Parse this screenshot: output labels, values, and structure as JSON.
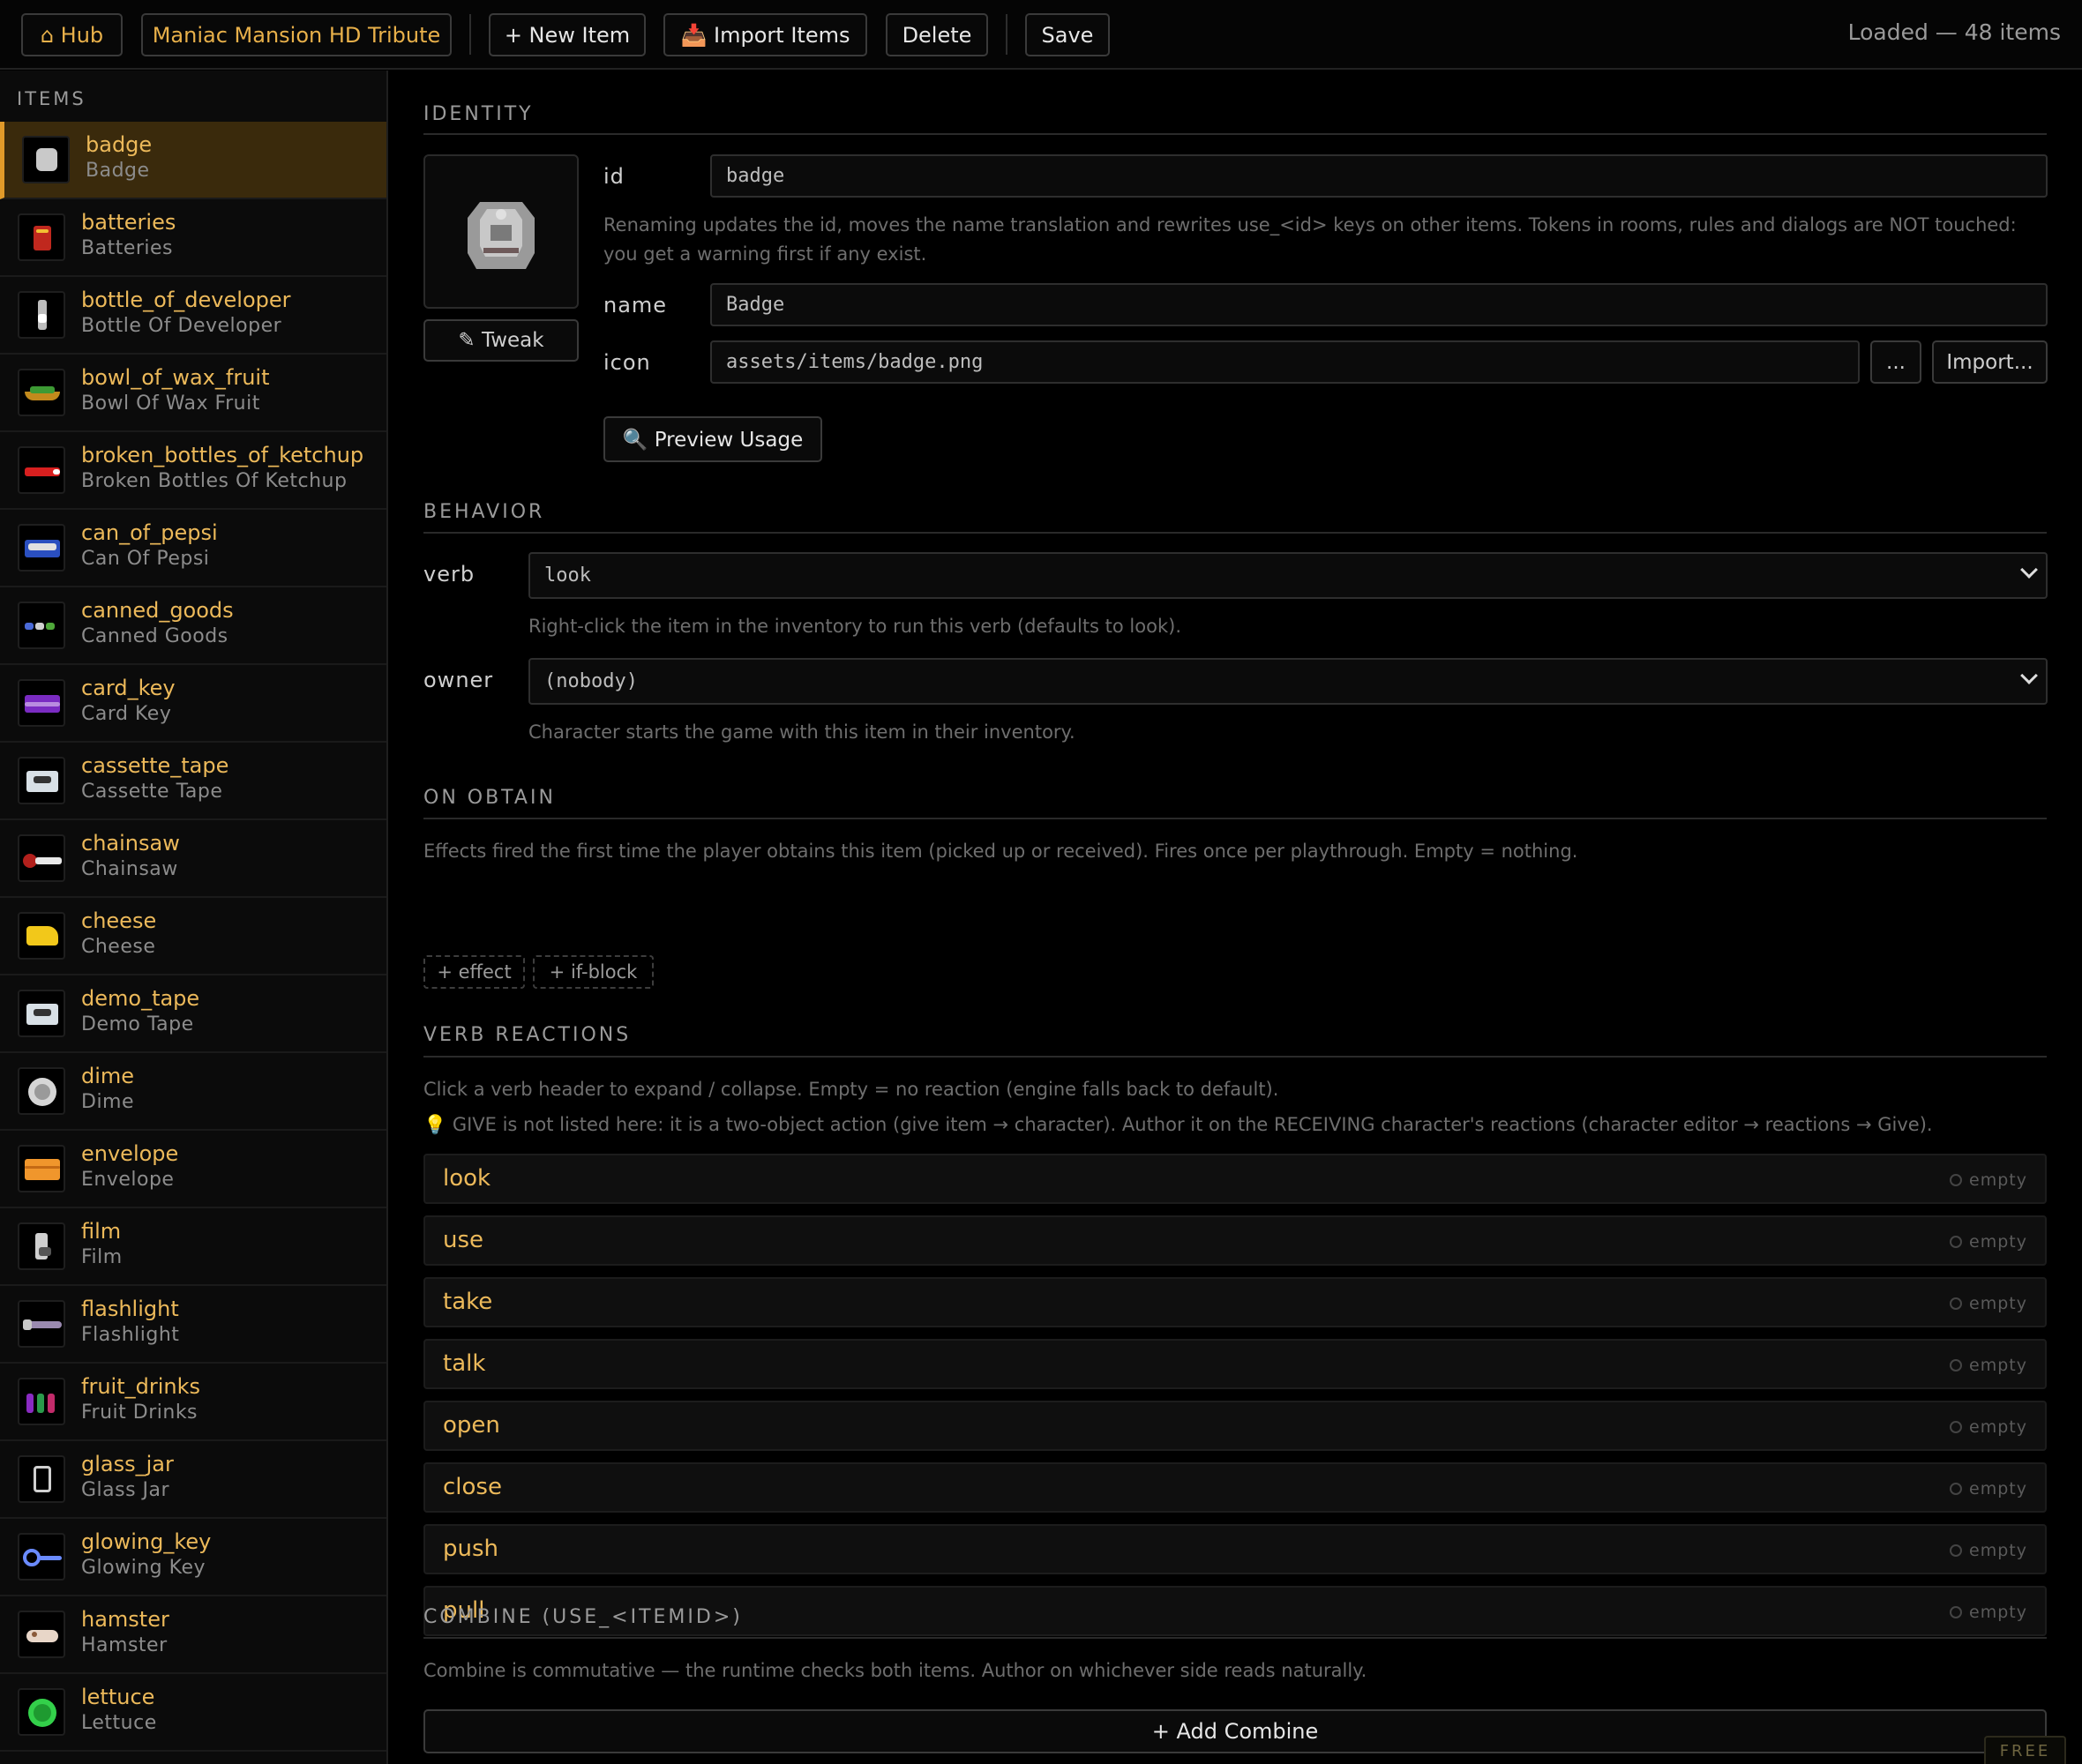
{
  "topbar": {
    "hub_label": "⌂ Hub",
    "project_label": "Maniac Mansion HD Tribute",
    "new_item_label": "+ New Item",
    "import_items_label": "📥 Import Items",
    "delete_label": "Delete",
    "save_label": "Save",
    "status": "Loaded — 48 items"
  },
  "sidebar": {
    "title": "ITEMS",
    "items": [
      {
        "id": "badge",
        "name": "Badge"
      },
      {
        "id": "batteries",
        "name": "Batteries"
      },
      {
        "id": "bottle_of_developer",
        "name": "Bottle Of Developer"
      },
      {
        "id": "bowl_of_wax_fruit",
        "name": "Bowl Of Wax Fruit"
      },
      {
        "id": "broken_bottles_of_ketchup",
        "name": "Broken Bottles Of Ketchup"
      },
      {
        "id": "can_of_pepsi",
        "name": "Can Of Pepsi"
      },
      {
        "id": "canned_goods",
        "name": "Canned Goods"
      },
      {
        "id": "card_key",
        "name": "Card Key"
      },
      {
        "id": "cassette_tape",
        "name": "Cassette Tape"
      },
      {
        "id": "chainsaw",
        "name": "Chainsaw"
      },
      {
        "id": "cheese",
        "name": "Cheese"
      },
      {
        "id": "demo_tape",
        "name": "Demo Tape"
      },
      {
        "id": "dime",
        "name": "Dime"
      },
      {
        "id": "envelope",
        "name": "Envelope"
      },
      {
        "id": "film",
        "name": "Film"
      },
      {
        "id": "flashlight",
        "name": "Flashlight"
      },
      {
        "id": "fruit_drinks",
        "name": "Fruit Drinks"
      },
      {
        "id": "glass_jar",
        "name": "Glass Jar"
      },
      {
        "id": "glowing_key",
        "name": "Glowing Key"
      },
      {
        "id": "hamster",
        "name": "Hamster"
      },
      {
        "id": "lettuce",
        "name": "Lettuce"
      }
    ]
  },
  "identity": {
    "title": "IDENTITY",
    "tweak_label": "✎ Tweak",
    "id_label": "id",
    "id_value": "badge",
    "rename_help": "Renaming updates the id, moves the name translation and rewrites use_<id> keys on other items. Tokens in rooms, rules and dialogs are NOT touched: you get a warning first if any exist.",
    "name_label": "name",
    "name_value": "Badge",
    "icon_label": "icon",
    "icon_value": "assets/items/badge.png",
    "browse_label": "...",
    "import_label": "Import...",
    "preview_label": "🔍 Preview Usage"
  },
  "behavior": {
    "title": "BEHAVIOR",
    "verb_label": "verb",
    "verb_value": "look",
    "verb_help": "Right-click the item in the inventory to run this verb (defaults to look).",
    "owner_label": "owner",
    "owner_value": "(nobody)",
    "owner_help": "Character starts the game with this item in their inventory."
  },
  "on_obtain": {
    "title": "ON OBTAIN",
    "help": "Effects fired the first time the player obtains this item (picked up or received). Fires once per playthrough. Empty = nothing.",
    "effect_label": "+ effect",
    "if_block_label": "+ if-block"
  },
  "verb_reactions": {
    "title": "VERB REACTIONS",
    "help": "Click a verb header to expand / collapse. Empty = no reaction (engine falls back to default).",
    "give_note": "💡 GIVE is not listed here: it is a two-object action (give item → character). Author it on the RECEIVING character's reactions (character editor → reactions → Give).",
    "verbs": [
      {
        "name": "look",
        "status": "empty"
      },
      {
        "name": "use",
        "status": "empty"
      },
      {
        "name": "take",
        "status": "empty"
      },
      {
        "name": "talk",
        "status": "empty"
      },
      {
        "name": "open",
        "status": "empty"
      },
      {
        "name": "close",
        "status": "empty"
      },
      {
        "name": "push",
        "status": "empty"
      },
      {
        "name": "pull",
        "status": "empty"
      }
    ]
  },
  "combine": {
    "title": "COMBINE (USE_<ITEMID>)",
    "help": "Combine is commutative — the runtime checks both items. Author on whichever side reads naturally.",
    "add_label": "+ Add Combine"
  },
  "footer": {
    "badge": "FREE"
  },
  "colors": {
    "accent": "#ecb95a",
    "selected_bg": "#3a2a0c",
    "selected_border": "#e09a2a"
  }
}
